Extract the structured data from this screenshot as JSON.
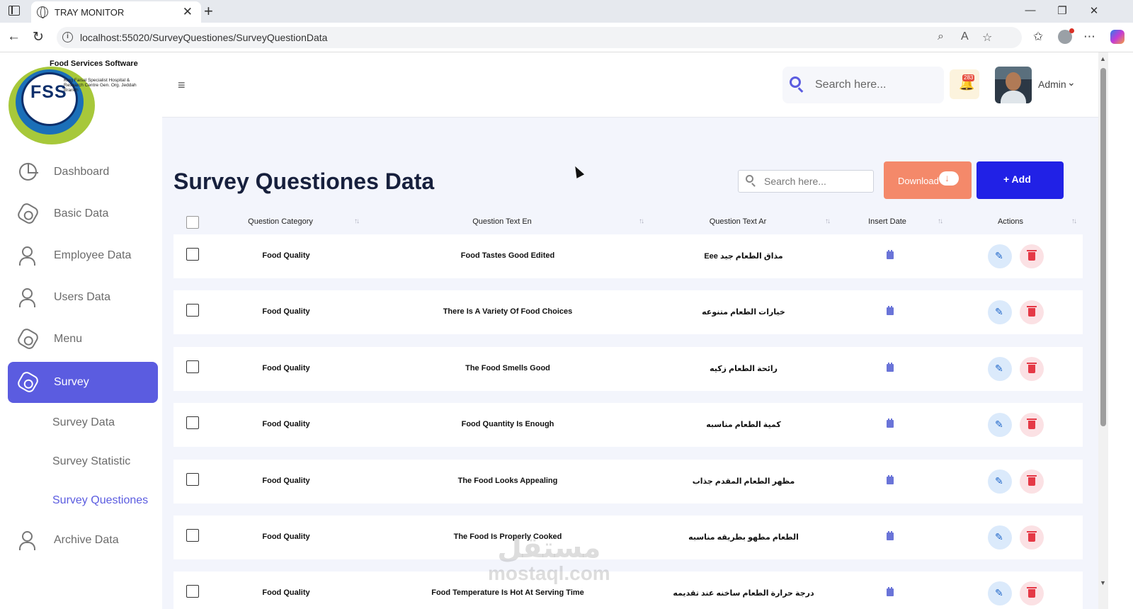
{
  "browser": {
    "tab_title": "TRAY MONITOR",
    "url": "localhost:55020/SurveyQuestiones/SurveyQuestionData",
    "tab_close": "✕",
    "new_tab": "+",
    "back": "←",
    "reload": "↻",
    "minimize": "—",
    "restore": "❐",
    "close": "✕",
    "zoom_icon": "⌕",
    "read_aloud_icon": "A",
    "favorite_icon": "☆",
    "favorites_icon": "✩",
    "more_icon": "⋯"
  },
  "sidebar": {
    "logo": {
      "title": "Food Services Software",
      "mark": "FSS",
      "subtitle": "King Faisal Specialist Hospital & Research Centre Gen. Org. Jeddah Branch"
    },
    "items": [
      {
        "label": "Dashboard",
        "icon": "pie-chart-icon"
      },
      {
        "label": "Basic Data",
        "icon": "hexagon-icon"
      },
      {
        "label": "Employee Data",
        "icon": "users-icon"
      },
      {
        "label": "Users Data",
        "icon": "users-icon"
      },
      {
        "label": "Menu",
        "icon": "hexagon-icon"
      },
      {
        "label": "Survey",
        "icon": "hexagon-icon",
        "active": true
      },
      {
        "label": "Archive Data",
        "icon": "users-icon"
      }
    ],
    "subitems": [
      {
        "label": "Survey Data"
      },
      {
        "label": "Survey Statistic"
      },
      {
        "label": "Survey Questiones",
        "current": true
      }
    ]
  },
  "header": {
    "menu_icon": "≡",
    "search_placeholder": "Search here...",
    "notifications_count": "283",
    "bell_icon": "🔔",
    "user_name": "Admin",
    "chevron": "⌄"
  },
  "page": {
    "title": "Survey Questiones Data",
    "search_placeholder": "Search here...",
    "download_label": "Download",
    "add_label": "+ Add",
    "sort_icon": "↑↓",
    "edit_icon": "✎"
  },
  "table": {
    "columns": [
      "Question Category",
      "Question Text En",
      "Question Text Ar",
      "Insert Date",
      "Actions"
    ],
    "rows": [
      {
        "category": "Food Quality",
        "text_en": "Food Tastes Good Edited",
        "text_ar": "مذاق الطعام جيد Eee"
      },
      {
        "category": "Food Quality",
        "text_en": "There Is A Variety Of Food Choices",
        "text_ar": "خيارات الطعام متنوعه"
      },
      {
        "category": "Food Quality",
        "text_en": "The Food Smells Good",
        "text_ar": "رائحة الطعام زكيه"
      },
      {
        "category": "Food Quality",
        "text_en": "Food Quantity Is Enough",
        "text_ar": "كمية الطعام مناسبه"
      },
      {
        "category": "Food Quality",
        "text_en": "The Food Looks Appealing",
        "text_ar": "مظهر الطعام المقدم جذاب"
      },
      {
        "category": "Food Quality",
        "text_en": "The Food Is Properly Cooked",
        "text_ar": "الطعام مطهو بطريقه مناسبه"
      },
      {
        "category": "Food Quality",
        "text_en": "Food Temperature Is Hot At Serving Time",
        "text_ar": "درجة حرارة الطعام ساخنه عند تقديمه"
      }
    ]
  },
  "watermark": {
    "arabic": "مستقل",
    "latin": "mostaql.com"
  }
}
